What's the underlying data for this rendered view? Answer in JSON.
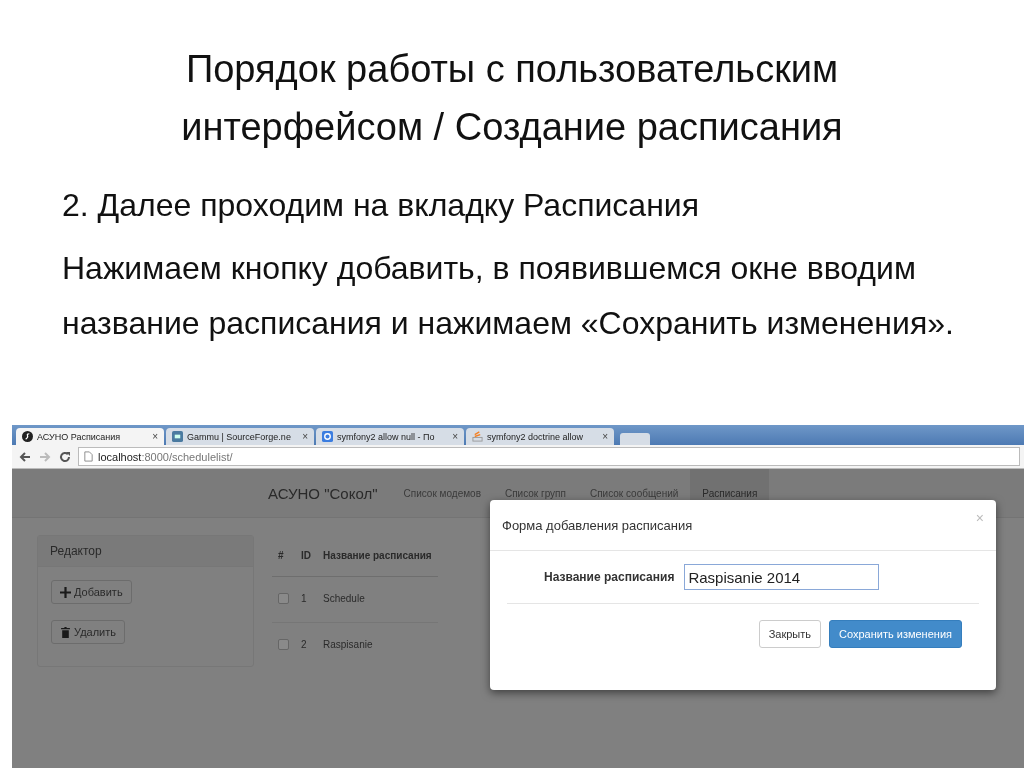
{
  "slide": {
    "title_lines": [
      "Порядок работы с пользовательским",
      "интерфейсом / Создание расписания"
    ],
    "paragraphs": [
      "2. Далее проходим на вкладку Расписания",
      "Нажимаем кнопку добавить, в появившемся окне вводим название расписания и нажимаем «Сохранить изменения»."
    ]
  },
  "browser": {
    "tabs": [
      {
        "label": "АСУНО Расписания",
        "selected": true,
        "kind": "symfony",
        "close": "×"
      },
      {
        "label": "Gammu | SourceForge.ne",
        "selected": false,
        "kind": "sourceforge",
        "close": "×"
      },
      {
        "label": "symfony2 allow null - По",
        "selected": false,
        "kind": "google",
        "close": "×"
      },
      {
        "label": "symfony2 doctrine allow",
        "selected": false,
        "kind": "stack",
        "close": "×"
      }
    ],
    "url_host": "localhost",
    "url_path": ":8000/schedulelist/"
  },
  "app": {
    "brand": "АСУНО \"Сокол\"",
    "nav": [
      {
        "label": "Список модемов",
        "selected": false
      },
      {
        "label": "Список групп",
        "selected": false
      },
      {
        "label": "Список сообщений",
        "selected": false
      },
      {
        "label": "Расписания",
        "selected": true
      }
    ],
    "editor": {
      "title": "Редактор",
      "buttons": [
        {
          "label": "Добавить",
          "kind": "add"
        },
        {
          "label": "Удалить",
          "kind": "delete"
        }
      ]
    },
    "table": {
      "columns": [
        "#",
        "ID",
        "Название расписания"
      ],
      "rows": [
        {
          "checked": false,
          "id": "1",
          "name": "Schedule"
        },
        {
          "checked": false,
          "id": "2",
          "name": "Raspisanie"
        }
      ]
    }
  },
  "modal": {
    "title": "Форма добавления расписания",
    "close": "×",
    "label": "Название расписания",
    "value": "Raspisanie 2014",
    "buttons": [
      {
        "label": "Закрыть",
        "kind": "default"
      },
      {
        "label": "Сохранить изменения",
        "kind": "primary"
      }
    ]
  }
}
